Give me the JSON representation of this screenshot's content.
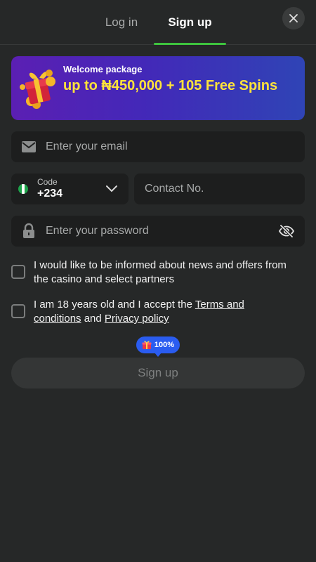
{
  "tabs": {
    "login_label": "Log in",
    "signup_label": "Sign up",
    "active": "signup"
  },
  "banner": {
    "subtitle": "Welcome package",
    "title": "up to ₦450,000 + 105 Free Spins"
  },
  "form": {
    "email_placeholder": "Enter your email",
    "code_label": "Code",
    "code_value": "+234",
    "phone_placeholder": "Contact No.",
    "password_placeholder": "Enter your password"
  },
  "consents": {
    "news_text": "I would like to be informed about news and offers from the casino and select partners",
    "age_prefix": "I am 18 years old and I accept the ",
    "terms_link": "Terms and conditions",
    "and_text": " and ",
    "privacy_link": "Privacy policy"
  },
  "bonus_badge": {
    "percent": "100%",
    "icon": "gift-icon"
  },
  "submit": {
    "label": "Sign up"
  },
  "colors": {
    "accent": "#3ec43e",
    "banner_text": "#ffe33a",
    "badge_blue": "#2a5cf0",
    "background": "#262828",
    "field_bg": "#1d1e1e"
  }
}
